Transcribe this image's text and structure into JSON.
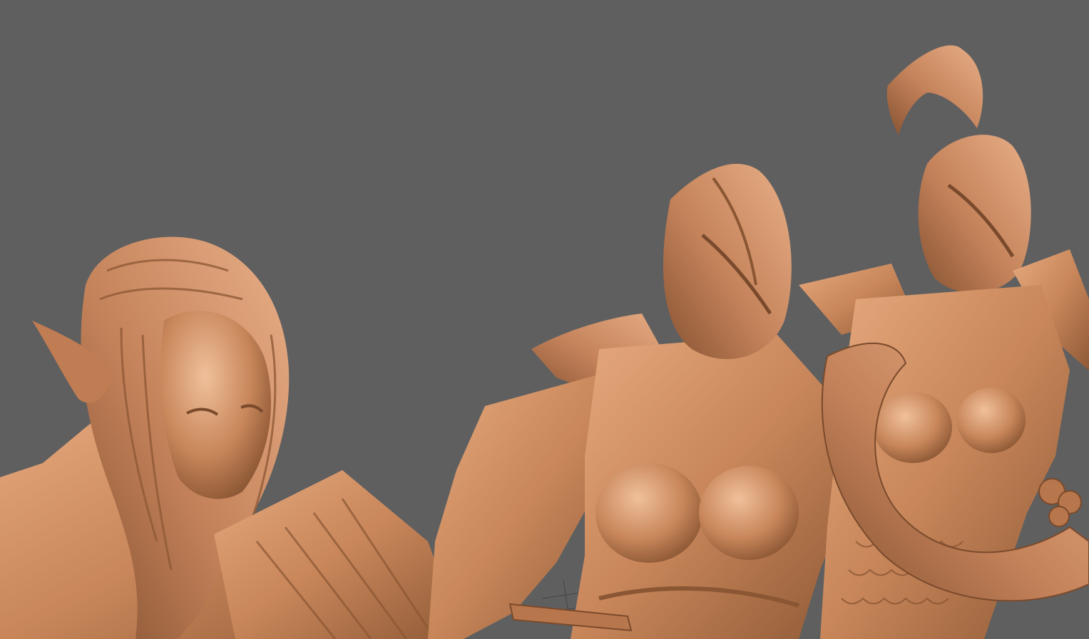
{
  "viewport": {
    "background_color": "#5f5f5f",
    "model_material_color": "#c8865a",
    "model_shadow_color": "#8a5633",
    "model_highlight_color": "#e9ae84",
    "grid_color": "#3a3a3a"
  },
  "models": [
    {
      "id": "elf-bust",
      "name_icon": "elf-figure-icon"
    },
    {
      "id": "helmeted-warrior-center",
      "name_icon": "helmeted-figure-icon"
    },
    {
      "id": "helmeted-warrior-right",
      "name_icon": "helmeted-figure-icon"
    }
  ]
}
